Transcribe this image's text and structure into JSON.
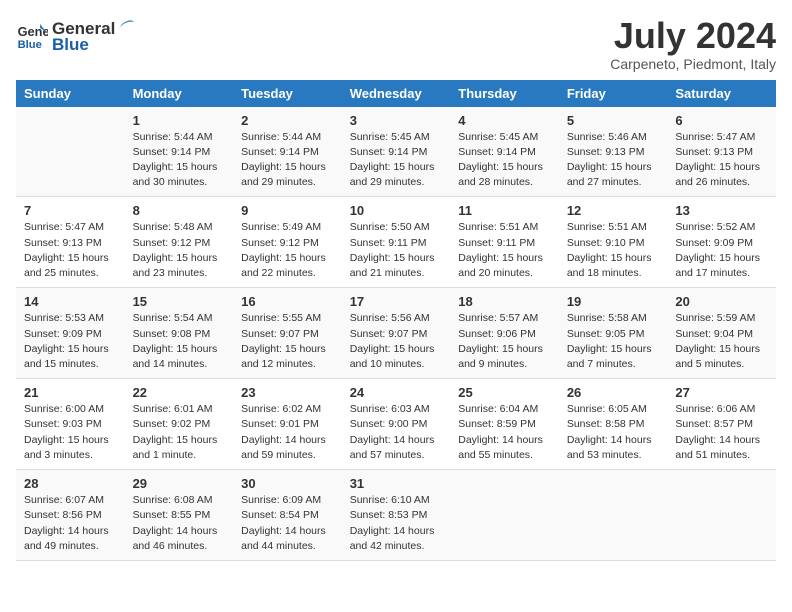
{
  "header": {
    "logo_line1": "General",
    "logo_line2": "Blue",
    "month_year": "July 2024",
    "location": "Carpeneto, Piedmont, Italy"
  },
  "days_of_week": [
    "Sunday",
    "Monday",
    "Tuesday",
    "Wednesday",
    "Thursday",
    "Friday",
    "Saturday"
  ],
  "weeks": [
    [
      {
        "day": "",
        "info": ""
      },
      {
        "day": "1",
        "info": "Sunrise: 5:44 AM\nSunset: 9:14 PM\nDaylight: 15 hours\nand 30 minutes."
      },
      {
        "day": "2",
        "info": "Sunrise: 5:44 AM\nSunset: 9:14 PM\nDaylight: 15 hours\nand 29 minutes."
      },
      {
        "day": "3",
        "info": "Sunrise: 5:45 AM\nSunset: 9:14 PM\nDaylight: 15 hours\nand 29 minutes."
      },
      {
        "day": "4",
        "info": "Sunrise: 5:45 AM\nSunset: 9:14 PM\nDaylight: 15 hours\nand 28 minutes."
      },
      {
        "day": "5",
        "info": "Sunrise: 5:46 AM\nSunset: 9:13 PM\nDaylight: 15 hours\nand 27 minutes."
      },
      {
        "day": "6",
        "info": "Sunrise: 5:47 AM\nSunset: 9:13 PM\nDaylight: 15 hours\nand 26 minutes."
      }
    ],
    [
      {
        "day": "7",
        "info": "Sunrise: 5:47 AM\nSunset: 9:13 PM\nDaylight: 15 hours\nand 25 minutes."
      },
      {
        "day": "8",
        "info": "Sunrise: 5:48 AM\nSunset: 9:12 PM\nDaylight: 15 hours\nand 23 minutes."
      },
      {
        "day": "9",
        "info": "Sunrise: 5:49 AM\nSunset: 9:12 PM\nDaylight: 15 hours\nand 22 minutes."
      },
      {
        "day": "10",
        "info": "Sunrise: 5:50 AM\nSunset: 9:11 PM\nDaylight: 15 hours\nand 21 minutes."
      },
      {
        "day": "11",
        "info": "Sunrise: 5:51 AM\nSunset: 9:11 PM\nDaylight: 15 hours\nand 20 minutes."
      },
      {
        "day": "12",
        "info": "Sunrise: 5:51 AM\nSunset: 9:10 PM\nDaylight: 15 hours\nand 18 minutes."
      },
      {
        "day": "13",
        "info": "Sunrise: 5:52 AM\nSunset: 9:09 PM\nDaylight: 15 hours\nand 17 minutes."
      }
    ],
    [
      {
        "day": "14",
        "info": "Sunrise: 5:53 AM\nSunset: 9:09 PM\nDaylight: 15 hours\nand 15 minutes."
      },
      {
        "day": "15",
        "info": "Sunrise: 5:54 AM\nSunset: 9:08 PM\nDaylight: 15 hours\nand 14 minutes."
      },
      {
        "day": "16",
        "info": "Sunrise: 5:55 AM\nSunset: 9:07 PM\nDaylight: 15 hours\nand 12 minutes."
      },
      {
        "day": "17",
        "info": "Sunrise: 5:56 AM\nSunset: 9:07 PM\nDaylight: 15 hours\nand 10 minutes."
      },
      {
        "day": "18",
        "info": "Sunrise: 5:57 AM\nSunset: 9:06 PM\nDaylight: 15 hours\nand 9 minutes."
      },
      {
        "day": "19",
        "info": "Sunrise: 5:58 AM\nSunset: 9:05 PM\nDaylight: 15 hours\nand 7 minutes."
      },
      {
        "day": "20",
        "info": "Sunrise: 5:59 AM\nSunset: 9:04 PM\nDaylight: 15 hours\nand 5 minutes."
      }
    ],
    [
      {
        "day": "21",
        "info": "Sunrise: 6:00 AM\nSunset: 9:03 PM\nDaylight: 15 hours\nand 3 minutes."
      },
      {
        "day": "22",
        "info": "Sunrise: 6:01 AM\nSunset: 9:02 PM\nDaylight: 15 hours\nand 1 minute."
      },
      {
        "day": "23",
        "info": "Sunrise: 6:02 AM\nSunset: 9:01 PM\nDaylight: 14 hours\nand 59 minutes."
      },
      {
        "day": "24",
        "info": "Sunrise: 6:03 AM\nSunset: 9:00 PM\nDaylight: 14 hours\nand 57 minutes."
      },
      {
        "day": "25",
        "info": "Sunrise: 6:04 AM\nSunset: 8:59 PM\nDaylight: 14 hours\nand 55 minutes."
      },
      {
        "day": "26",
        "info": "Sunrise: 6:05 AM\nSunset: 8:58 PM\nDaylight: 14 hours\nand 53 minutes."
      },
      {
        "day": "27",
        "info": "Sunrise: 6:06 AM\nSunset: 8:57 PM\nDaylight: 14 hours\nand 51 minutes."
      }
    ],
    [
      {
        "day": "28",
        "info": "Sunrise: 6:07 AM\nSunset: 8:56 PM\nDaylight: 14 hours\nand 49 minutes."
      },
      {
        "day": "29",
        "info": "Sunrise: 6:08 AM\nSunset: 8:55 PM\nDaylight: 14 hours\nand 46 minutes."
      },
      {
        "day": "30",
        "info": "Sunrise: 6:09 AM\nSunset: 8:54 PM\nDaylight: 14 hours\nand 44 minutes."
      },
      {
        "day": "31",
        "info": "Sunrise: 6:10 AM\nSunset: 8:53 PM\nDaylight: 14 hours\nand 42 minutes."
      },
      {
        "day": "",
        "info": ""
      },
      {
        "day": "",
        "info": ""
      },
      {
        "day": "",
        "info": ""
      }
    ]
  ]
}
